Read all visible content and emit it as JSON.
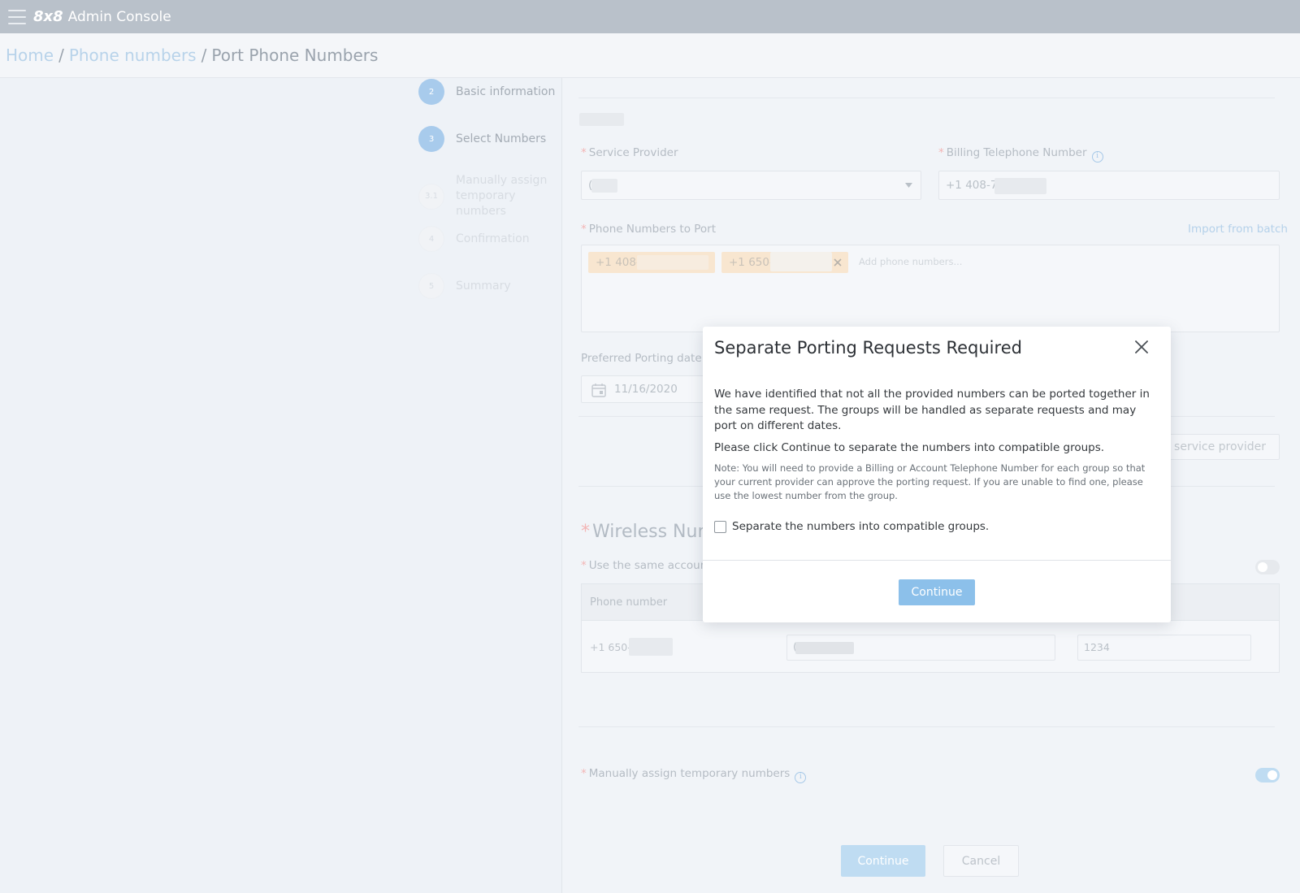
{
  "app": {
    "logo": "8x8",
    "title": "Admin Console"
  },
  "breadcrumb": {
    "home": "Home",
    "sep1": "/",
    "phone_numbers": "Phone numbers",
    "sep2": "/",
    "current": "Port Phone Numbers"
  },
  "steps": [
    {
      "number": "2",
      "label": "Basic information"
    },
    {
      "number": "3",
      "label": "Select Numbers"
    },
    {
      "number": "3.1",
      "label": "Manually assign temporary numbers"
    },
    {
      "number": "4",
      "label": "Confirmation"
    },
    {
      "number": "5",
      "label": "Summary"
    }
  ],
  "form": {
    "required_mark": "*",
    "service_provider_label": "Service Provider",
    "service_provider_value": "(",
    "billing_label": "Billing Telephone Number",
    "billing_value": "+1 408-7",
    "phone_numbers_label": "Phone Numbers to Port",
    "import_link": "Import from batch",
    "chips": [
      "+1 408-7",
      "+1 650-7"
    ],
    "add_placeholder": "Add phone numbers...",
    "porting_date_label": "Preferred Porting date",
    "porting_date_value": "11/16/2020",
    "new_provider_button": "ew service provider",
    "wireless_title": "Wireless Num",
    "same_account_label": "Use the same account",
    "table_header_phone": "Phone number",
    "table_row_phone": "+1 650-7",
    "table_row_middle": "(",
    "table_row_pin": "1234",
    "manually_assign_label": "Manually assign temporary numbers",
    "continue_button": "Continue",
    "cancel_button": "Cancel"
  },
  "modal": {
    "title": "Separate Porting Requests Required",
    "paragraph1": "We have identified that not all the provided numbers can be ported together in the same request. The groups will be handled as separate requests and may port on different dates.",
    "paragraph2": "Please click Continue to separate the numbers into compatible groups.",
    "note": "Note: You will need to provide a Billing or Account Telephone Number for each group so that your current provider can approve the porting request. If you are unable to find one, please use the lowest number from the group.",
    "checkbox_label": "Separate the numbers into compatible groups.",
    "continue_button": "Continue"
  },
  "icons": {
    "menu": "hamburger-icon",
    "info": "info-icon",
    "calendar": "calendar-icon",
    "dropdown": "caret-down-icon",
    "remove_chip": "close-icon",
    "modal_close": "close-icon"
  },
  "colors": {
    "topbar": "#b9c1ca",
    "accent": "#8cc0ea",
    "chip": "#f8e6d0",
    "required": "#f3b5b5"
  }
}
